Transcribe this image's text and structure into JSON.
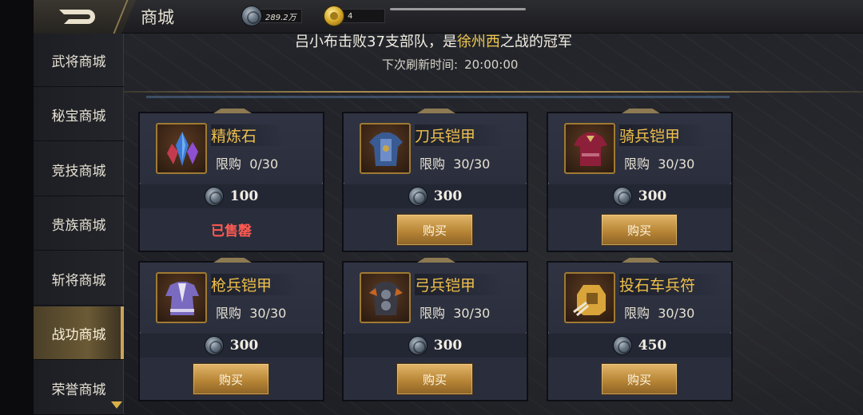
{
  "header": {
    "title": "商城",
    "currencies": [
      {
        "icon": "silver-coin-icon",
        "value": "289.2万"
      },
      {
        "icon": "gold-coin-icon",
        "value": "4"
      }
    ]
  },
  "sidebar": {
    "items": [
      {
        "label": "武将商城"
      },
      {
        "label": "秘宝商城"
      },
      {
        "label": "竞技商城"
      },
      {
        "label": "贵族商城"
      },
      {
        "label": "斩将商城"
      },
      {
        "label": "战功商城"
      },
      {
        "label": "荣誉商城"
      }
    ],
    "active_index": 5
  },
  "notice": {
    "part1": "吕小布击败37支部队，是",
    "highlight": "徐州西",
    "part2": "之战的冠军"
  },
  "refresh": {
    "label": "下次刷新时间:",
    "time": "20:00:00"
  },
  "items": [
    {
      "name": "精炼石",
      "limit_label": "限购",
      "limit": "0/30",
      "price": "100",
      "status": "已售罄",
      "icon": "refine-stone-icon"
    },
    {
      "name": "刀兵铠甲",
      "limit_label": "限购",
      "limit": "30/30",
      "price": "300",
      "button": "购买",
      "icon": "blade-armor-icon"
    },
    {
      "name": "骑兵铠甲",
      "limit_label": "限购",
      "limit": "30/30",
      "price": "300",
      "button": "购买",
      "icon": "cavalry-armor-icon"
    },
    {
      "name": "枪兵铠甲",
      "limit_label": "限购",
      "limit": "30/30",
      "price": "300",
      "button": "购买",
      "icon": "spear-armor-icon"
    },
    {
      "name": "弓兵铠甲",
      "limit_label": "限购",
      "limit": "30/30",
      "price": "300",
      "button": "购买",
      "icon": "archer-armor-icon"
    },
    {
      "name": "投石车兵符",
      "limit_label": "限购",
      "limit": "30/30",
      "price": "450",
      "button": "购买",
      "icon": "catapult-token-icon"
    }
  ],
  "colors": {
    "accent_gold": "#f0c04c",
    "sold_out_red": "#ff5a52",
    "card_bg": "#2a2e3c"
  }
}
